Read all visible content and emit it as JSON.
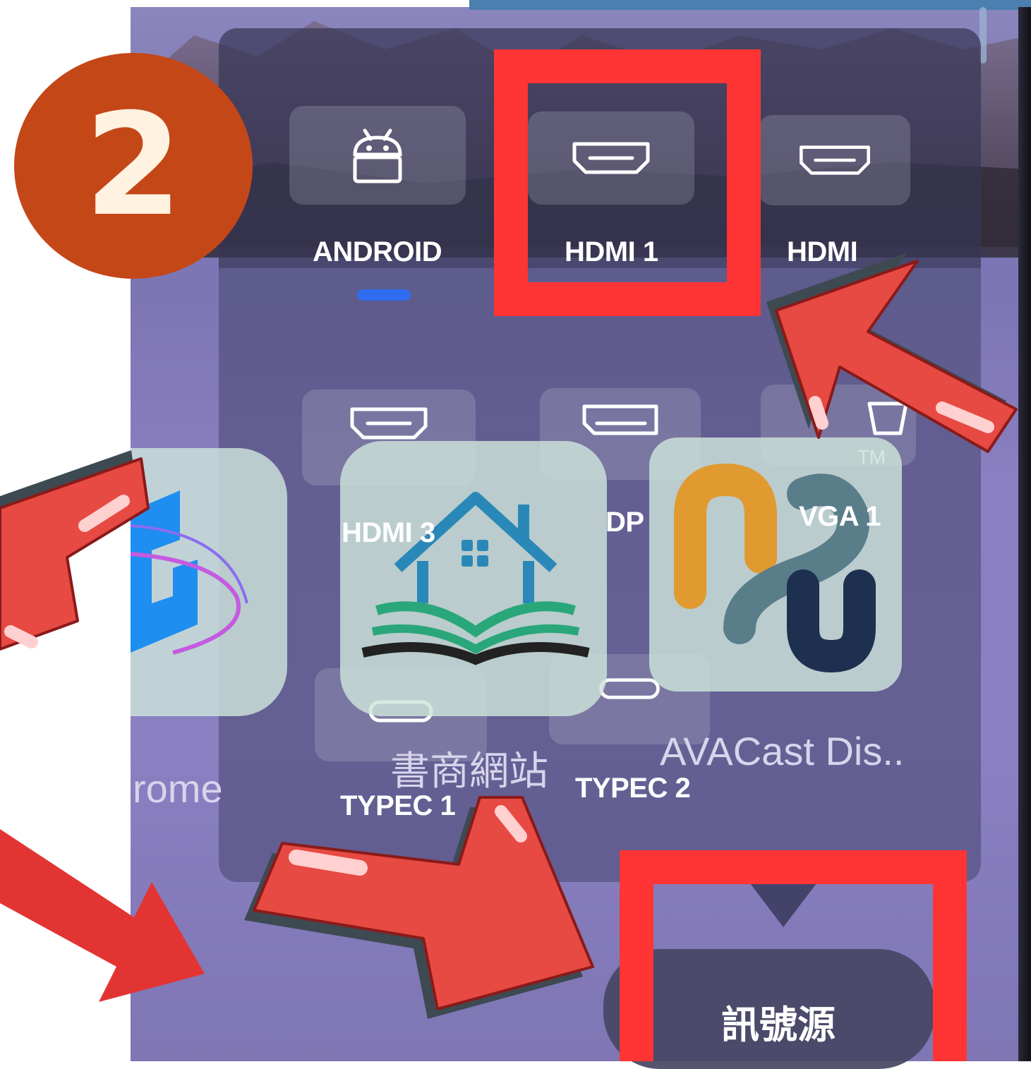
{
  "badge": {
    "number": "2"
  },
  "sources": {
    "row1": [
      {
        "label": "ANDROID",
        "icon": "android-icon"
      },
      {
        "label": "HDMI 1",
        "icon": "hdmi-port-icon"
      },
      {
        "label": "HDMI",
        "icon": "hdmi-port-icon"
      }
    ],
    "row2": [
      {
        "label": "HDMI 3",
        "icon": "hdmi-port-icon"
      },
      {
        "label": "DP",
        "icon": "displayport-icon"
      },
      {
        "label": "VGA 1",
        "icon": "vga-port-icon"
      }
    ],
    "row3": [
      {
        "label": "TYPEC 1",
        "icon": "usb-c-icon"
      },
      {
        "label": "TYPEC 2",
        "icon": "usb-c-icon"
      }
    ],
    "tm_mark": "TM"
  },
  "apps": [
    {
      "label": "rome",
      "icon": "chrome-app-icon"
    },
    {
      "label": "書商網站",
      "icon": "bookstore-house-icon"
    },
    {
      "label": "AVACast Dis..",
      "icon": "avacast-app-icon"
    }
  ],
  "source_button": {
    "label": "訊號源"
  },
  "colors": {
    "annotation_red": "#ff3434",
    "arrow_red": "#e64a42",
    "badge": "#c44718",
    "active_indicator": "#2f6cf0"
  }
}
